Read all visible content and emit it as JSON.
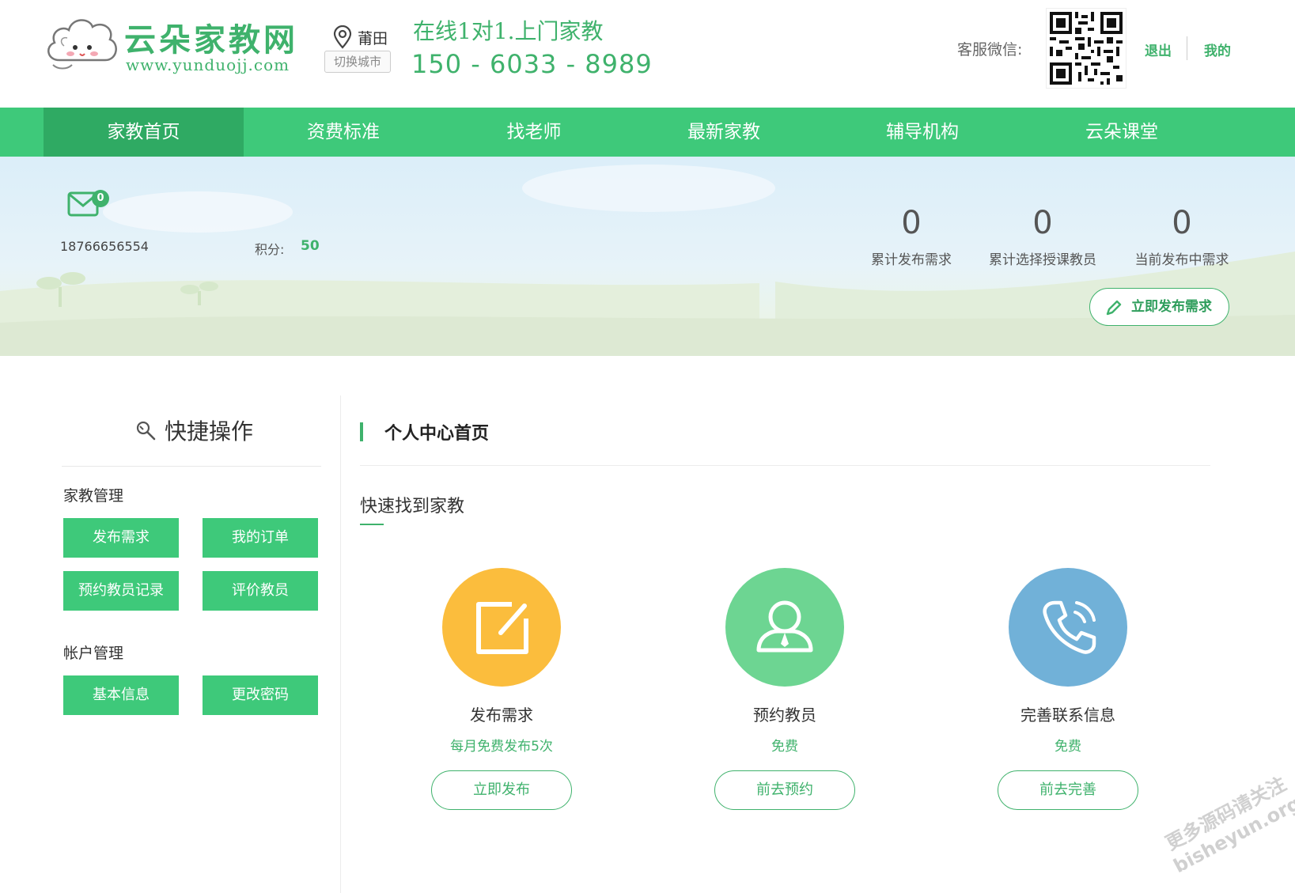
{
  "header": {
    "logo_title": "云朵家教网",
    "logo_url": "www.yunduojj.com",
    "city": "莆田",
    "city_switch": "切换城市",
    "slogan": "在线1对1.上门家教",
    "hotline": "150 - 6033 - 8989",
    "service_wechat_label": "客服微信:",
    "logout": "退出",
    "mine": "我的"
  },
  "nav": {
    "items": [
      "家教首页",
      "资费标准",
      "找老师",
      "最新家教",
      "辅导机构",
      "云朵课堂"
    ],
    "active_index": 0
  },
  "user": {
    "message_count": "0",
    "phone": "18766656554",
    "points_label": "积分:",
    "points_value": "50"
  },
  "stats": [
    {
      "value": "0",
      "label": "累计发布需求"
    },
    {
      "value": "0",
      "label": "累计选择授课教员"
    },
    {
      "value": "0",
      "label": "当前发布中需求"
    }
  ],
  "publish_button": "立即发布需求",
  "sidebar": {
    "title": "快捷操作",
    "groups": [
      {
        "title": "家教管理",
        "buttons": [
          "发布需求",
          "我的订单",
          "预约教员记录",
          "评价教员"
        ]
      },
      {
        "title": "帐户管理",
        "buttons": [
          "基本信息",
          "更改密码"
        ]
      }
    ]
  },
  "main": {
    "title": "个人中心首页",
    "subtitle": "快速找到家教",
    "cards": [
      {
        "title": "发布需求",
        "sub": "每月免费发布5次",
        "button": "立即发布",
        "color": "#fbbd3d",
        "icon": "edit-icon"
      },
      {
        "title": "预约教员",
        "sub": "免费",
        "button": "前去预约",
        "color": "#6dd592",
        "icon": "teacher-icon"
      },
      {
        "title": "完善联系信息",
        "sub": "免费",
        "button": "前去完善",
        "color": "#71b1d8",
        "icon": "phone-icon"
      }
    ]
  },
  "watermark": {
    "line1": "更多源码请关注",
    "line2": "bisheyun.org"
  },
  "colors": {
    "brand_green": "#3ec97a",
    "nav_active": "#2faa63",
    "text_green": "#3fb26c"
  }
}
